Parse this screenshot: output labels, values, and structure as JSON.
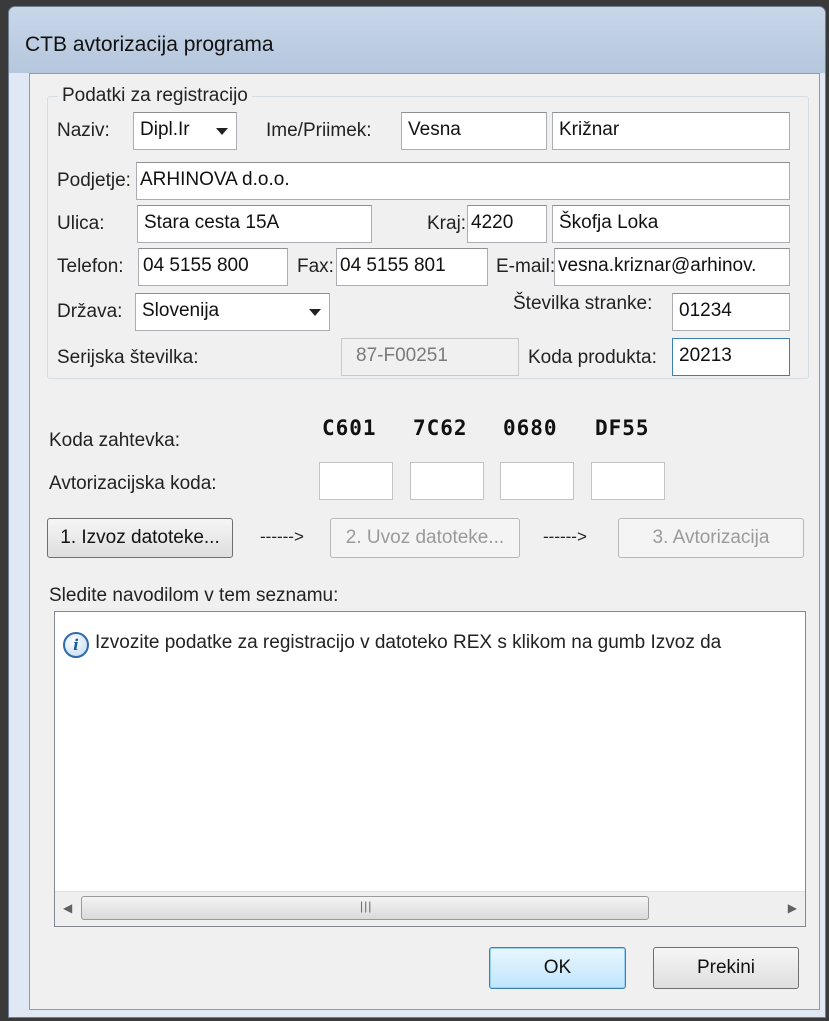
{
  "window": {
    "title": "CTB avtorizacija programa"
  },
  "registration": {
    "group_label": "Podatki za registracijo",
    "naziv_label": "Naziv:",
    "naziv_value": "Dipl.Ir",
    "ime_priimek_label": "Ime/Priimek:",
    "ime_value": "Vesna",
    "priimek_value": "Križnar",
    "podjetje_label": "Podjetje:",
    "podjetje_value": "ARHINOVA d.o.o.",
    "ulica_label": "Ulica:",
    "ulica_value": "Stara cesta 15A",
    "kraj_label": "Kraj:",
    "postna_value": "4220",
    "kraj_value": "Škofja Loka",
    "telefon_label": "Telefon:",
    "telefon_value": "04 5155 800",
    "fax_label": "Fax:",
    "fax_value": "04 5155 801",
    "email_label": "E-mail:",
    "email_value": "vesna.kriznar@arhinov.",
    "drzava_label": "Država:",
    "drzava_value": "Slovenija",
    "stevilka_stranke_label": "Številka stranke:",
    "stevilka_stranke_value": "01234",
    "serijska_label": "Serijska številka:",
    "serijska_value": "87-F00251",
    "koda_produkta_label": "Koda produkta:",
    "koda_produkta_value": "20213"
  },
  "codes": {
    "koda_zahtevka_label": "Koda zahtevka:",
    "koda_zahtevka": [
      "C601",
      "7C62",
      "0680",
      "DF55"
    ],
    "avtorizacijska_label": "Avtorizacijska koda:",
    "avtorizacijska": [
      "",
      "",
      "",
      ""
    ]
  },
  "steps": {
    "step1": "1. Izvoz datoteke...",
    "arrow1": "------>",
    "step2": "2. Uvoz datoteke...",
    "arrow2": "------>",
    "step3": "3. Avtorizacija"
  },
  "instructions": {
    "label": "Sledite navodilom v tem seznamu:",
    "message": "Izvozite podatke za registracijo v datoteko REX s klikom na gumb Izvoz da",
    "icon": "info-icon"
  },
  "buttons": {
    "ok": "OK",
    "cancel": "Prekini"
  },
  "colors": {
    "titlebar": "#b5c7de",
    "dialog_bg": "#f0f0f0",
    "default_button_border": "#3c7fb1",
    "info_icon": "#2e6aa8"
  }
}
